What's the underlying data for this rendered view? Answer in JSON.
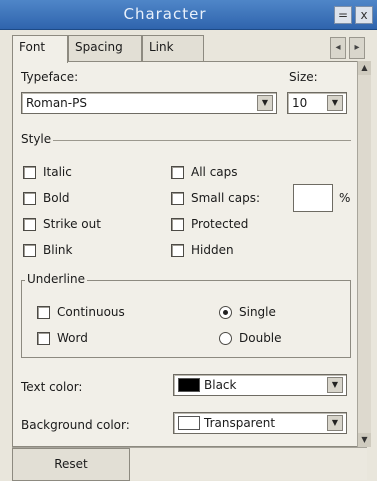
{
  "window": {
    "title": "Character",
    "minimize": "=",
    "close": "x"
  },
  "tabs": [
    {
      "label": "Font"
    },
    {
      "label": "Spacing"
    },
    {
      "label": "Link"
    }
  ],
  "tab_scroll": {
    "left": "◂",
    "right": "▸"
  },
  "typeface": {
    "label": "Typeface:",
    "value": "Roman-PS"
  },
  "size": {
    "label": "Size:",
    "value": "10"
  },
  "style": {
    "legend": "Style",
    "left": [
      "Italic",
      "Bold",
      "Strike out",
      "Blink"
    ],
    "right": [
      "All caps",
      "Small caps:",
      "Protected",
      "Hidden"
    ],
    "pct_symbol": "%"
  },
  "underline": {
    "legend": "Underline",
    "checks": [
      "Continuous",
      "Word"
    ],
    "radios": [
      "Single",
      "Double"
    ],
    "selected": "Single"
  },
  "text_color": {
    "label": "Text color:",
    "value": "Black",
    "swatch": "#000000"
  },
  "background_color": {
    "label": "Background color:",
    "value": "Transparent",
    "swatch": "#ffffff"
  },
  "reset_label": "Reset",
  "dropdown_arrow": "▼",
  "scroll_arrows": {
    "up": "▲",
    "down": "▼"
  }
}
